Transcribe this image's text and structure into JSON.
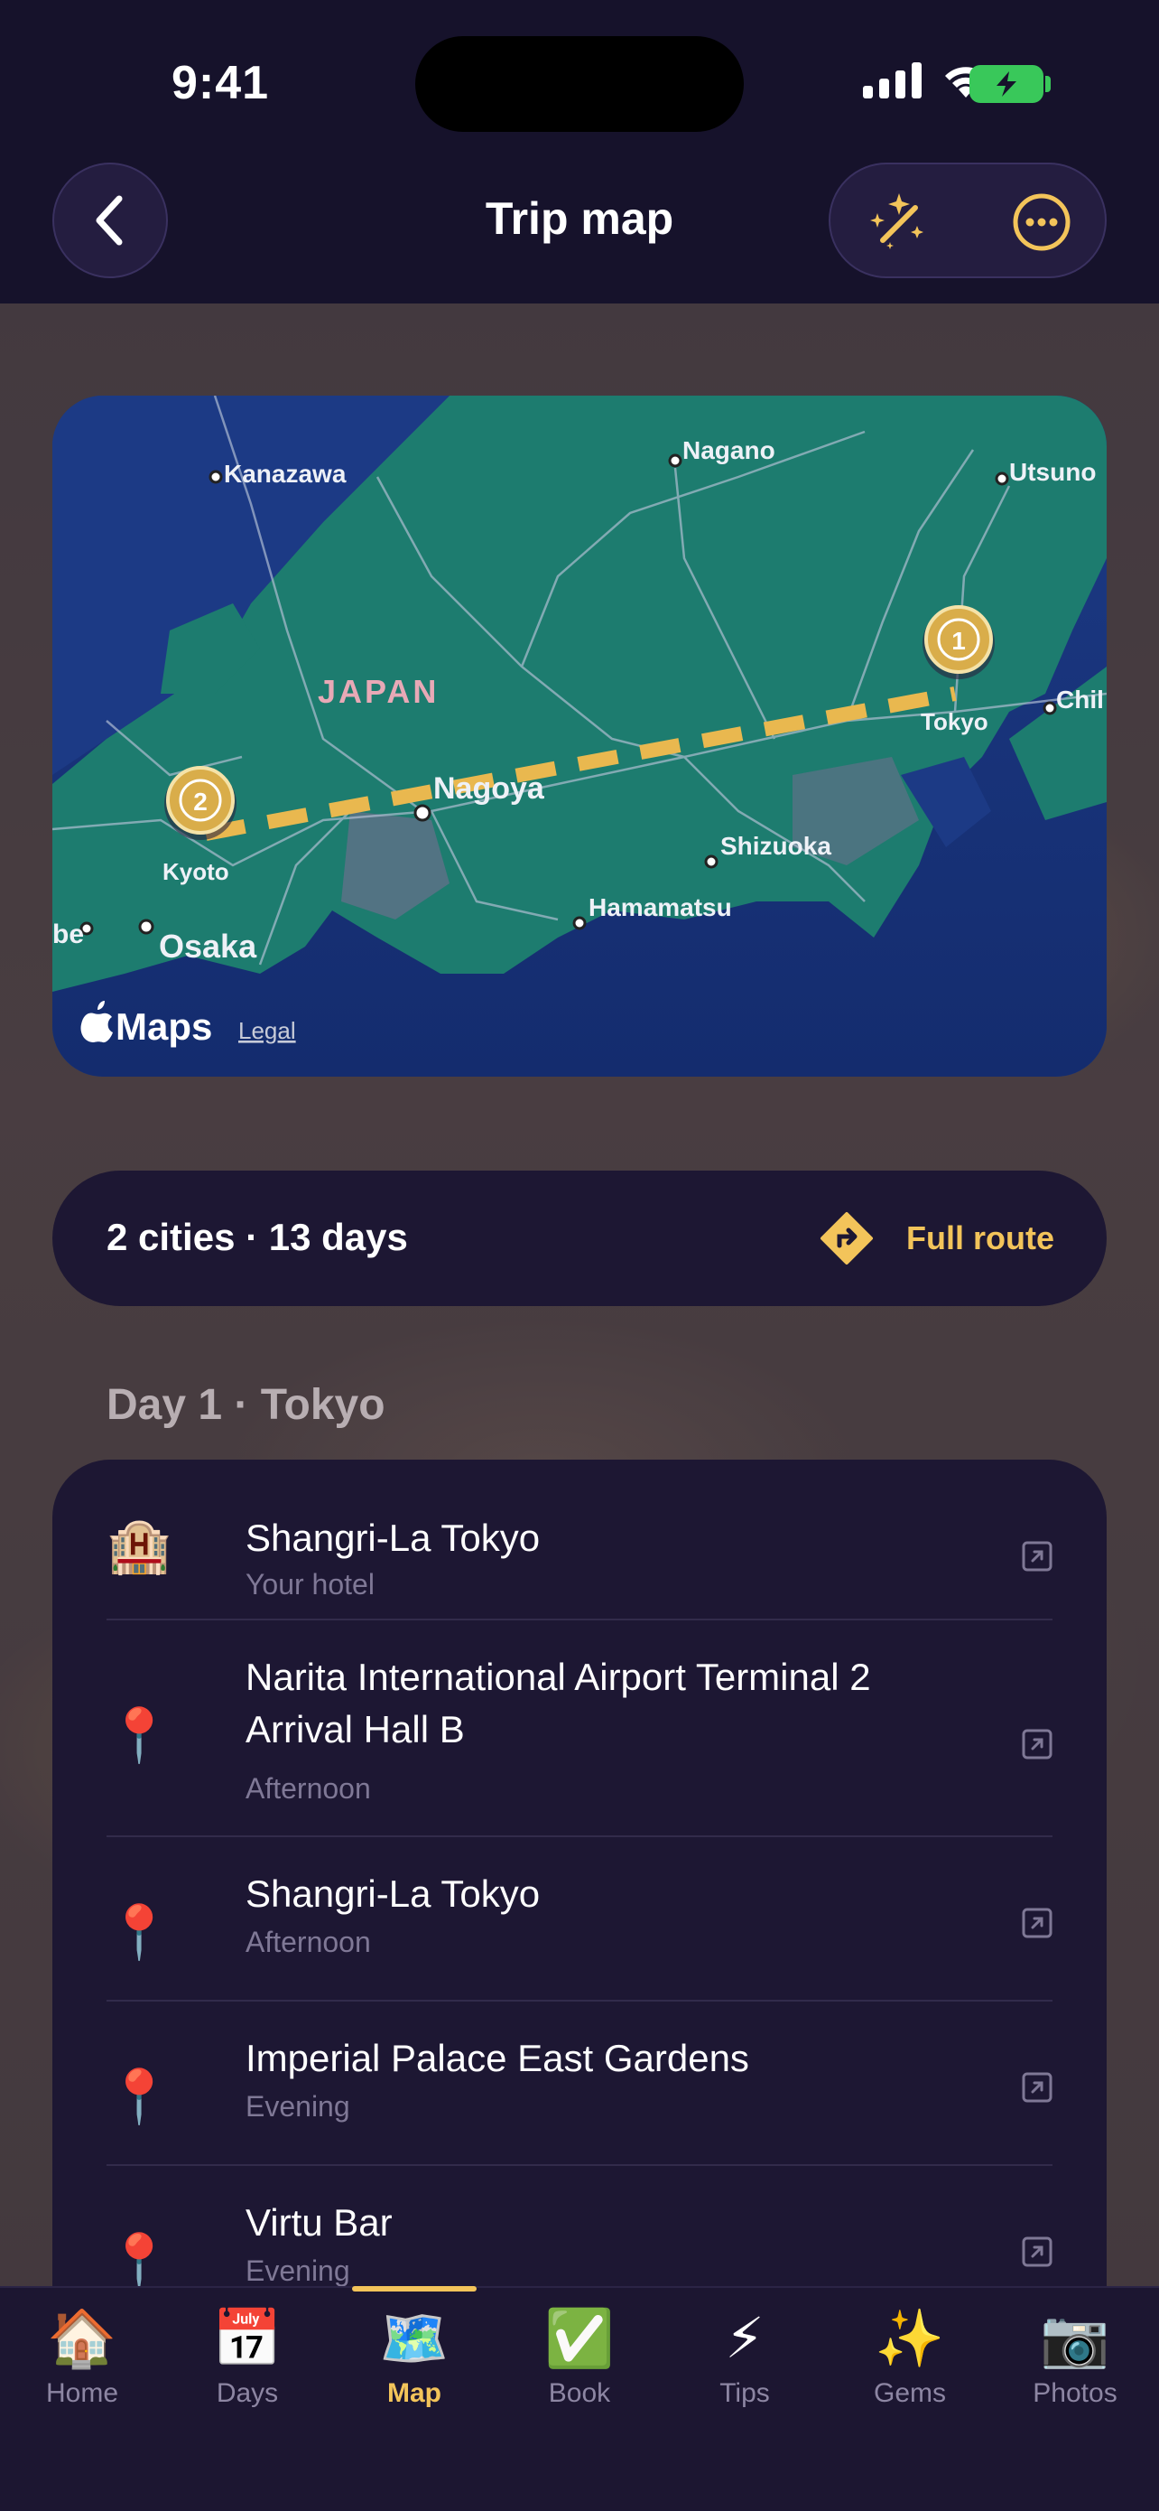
{
  "status_bar": {
    "time": "9:41"
  },
  "header": {
    "title": "Trip map"
  },
  "map": {
    "labels": {
      "kanazawa": "Kanazawa",
      "nagano": "Nagano",
      "utsunomiya": "Utsuno",
      "japan": "JAPAN",
      "chiba": "Chil",
      "tokyo": "Tokyo",
      "nagoya": "Nagoya",
      "kyoto": "Kyoto",
      "shizuoka": "Shizuoka",
      "hamamatsu": "Hamamatsu",
      "osaka": "Osaka",
      "kobe": "be"
    },
    "markers": [
      {
        "number": "1",
        "city": "Tokyo"
      },
      {
        "number": "2",
        "city": "Kyoto"
      }
    ],
    "attribution": "Maps",
    "legal": "Legal"
  },
  "summary": {
    "text": "2 cities · 13 days",
    "route_label": "Full route"
  },
  "day": {
    "heading": "Day 1 · Tokyo",
    "items": [
      {
        "icon": "🏨",
        "icon_name": "hotel-icon",
        "name": "Shangri-La Tokyo",
        "sub": "Your hotel"
      },
      {
        "icon": "📍",
        "icon_name": "pin-icon",
        "name": "Narita International Airport Terminal 2 Arrival Hall B",
        "sub": "Afternoon"
      },
      {
        "icon": "📍",
        "icon_name": "pin-icon",
        "name": "Shangri-La Tokyo",
        "sub": "Afternoon"
      },
      {
        "icon": "📍",
        "icon_name": "pin-icon",
        "name": "Imperial Palace East Gardens",
        "sub": "Evening"
      },
      {
        "icon": "📍",
        "icon_name": "pin-icon",
        "name": "Virtu Bar",
        "sub": "Evening"
      }
    ]
  },
  "tabs": [
    {
      "icon": "🏠",
      "label": "Home"
    },
    {
      "icon": "📅",
      "label": "Days"
    },
    {
      "icon": "🗺️",
      "label": "Map",
      "active": true
    },
    {
      "icon": "✅",
      "label": "Book"
    },
    {
      "icon": "⚡",
      "label": "Tips"
    },
    {
      "icon": "✨",
      "label": "Gems"
    },
    {
      "icon": "📷",
      "label": "Photos"
    }
  ],
  "colors": {
    "accent": "#f3c45a",
    "background": "#16122b",
    "card": "#1d1733"
  }
}
